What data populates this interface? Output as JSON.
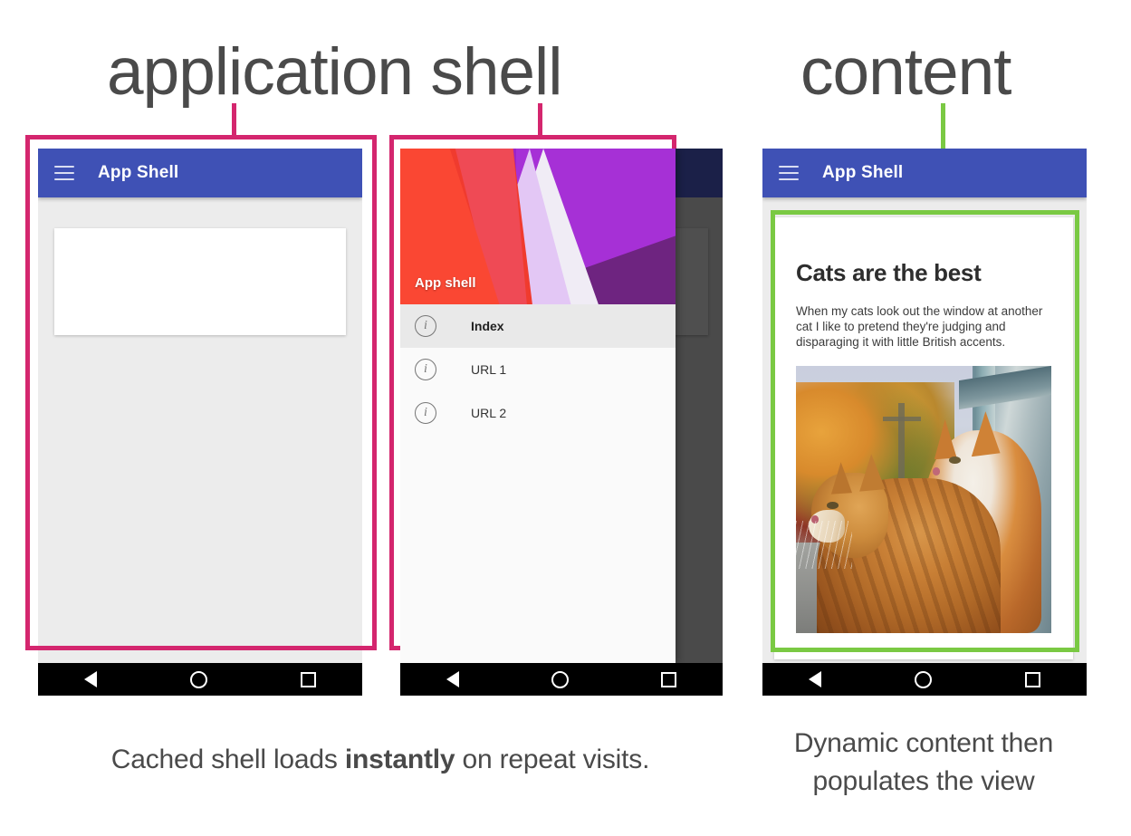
{
  "headings": {
    "left": "application shell",
    "right": "content"
  },
  "colors": {
    "annotation_pink": "#d4266e",
    "annotation_green": "#7ac943",
    "appbar_blue": "#3f51b5",
    "screen_gray": "#ececec",
    "navbar_black": "#000000"
  },
  "phones": {
    "shell": {
      "appbar": {
        "menu_icon": "hamburger-icon",
        "title": "App Shell"
      },
      "card_placeholder": ""
    },
    "drawer": {
      "appbar": {
        "menu_icon": "hamburger-icon",
        "title": "App Shell"
      },
      "drawer_header_title": "App shell",
      "items": [
        {
          "label": "Index",
          "icon": "info-icon",
          "active": true
        },
        {
          "label": "URL 1",
          "icon": "info-icon",
          "active": false
        },
        {
          "label": "URL 2",
          "icon": "info-icon",
          "active": false
        }
      ]
    },
    "content": {
      "appbar": {
        "menu_icon": "hamburger-icon",
        "title": "App Shell"
      },
      "article": {
        "title": "Cats are the best",
        "body": "When my cats look out the window at another cat I like to pretend they're judging and disparaging it with little British accents.",
        "image_alt": "two orange cats looking out a window at autumn trees"
      }
    }
  },
  "navbar": {
    "back": "back-triangle-icon",
    "home": "home-circle-icon",
    "recents": "recents-square-icon"
  },
  "captions": {
    "left_part1": "Cached shell loads ",
    "left_emphasis": "instantly",
    "left_part2": " on repeat visits.",
    "right": "Dynamic content then populates the view"
  }
}
